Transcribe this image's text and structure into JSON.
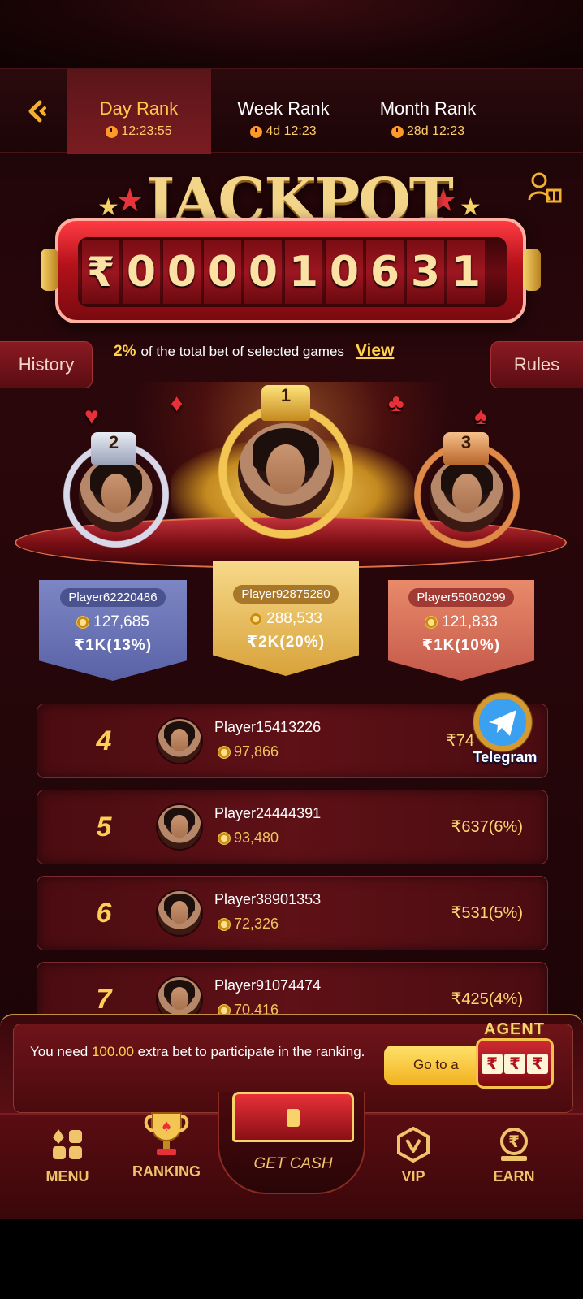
{
  "tabs": [
    {
      "label": "Day Rank",
      "timer": "12:23:55",
      "active": true
    },
    {
      "label": "Week Rank",
      "timer": "4d 12:23",
      "active": false
    },
    {
      "label": "Month Rank",
      "timer": "28d 12:23",
      "active": false
    }
  ],
  "jackpot": {
    "title": "JACKPOT",
    "currency": "₹",
    "digits": [
      "0",
      "0",
      "0",
      "0",
      "1",
      "0",
      "6",
      "3",
      "1"
    ]
  },
  "info": {
    "history": "History",
    "rules": "Rules",
    "percent": "2%",
    "text": "of the total bet of selected games",
    "view": "View"
  },
  "podium": {
    "first": {
      "rank": "1",
      "name": "Player92875280",
      "coins": "288,533",
      "prize": "₹2K(20%)"
    },
    "second": {
      "rank": "2",
      "name": "Player62220486",
      "coins": "127,685",
      "prize": "₹1K(13%)"
    },
    "third": {
      "rank": "3",
      "name": "Player55080299",
      "coins": "121,833",
      "prize": "₹1K(10%)"
    }
  },
  "ranks": [
    {
      "num": "4",
      "name": "Player15413226",
      "coins": "97,866",
      "prize": "₹74"
    },
    {
      "num": "5",
      "name": "Player24444391",
      "coins": "93,480",
      "prize": "₹637(6%)"
    },
    {
      "num": "6",
      "name": "Player38901353",
      "coins": "72,326",
      "prize": "₹531(5%)"
    },
    {
      "num": "7",
      "name": "Player91074474",
      "coins": "70,416",
      "prize": "₹425(4%)"
    }
  ],
  "telegram": "Telegram",
  "notice": {
    "pre": "You need ",
    "amount": "100.00",
    "post": " extra bet to participate in the ranking.",
    "button": "Go to a"
  },
  "agent": {
    "label": "AGENT",
    "symbol": "₹"
  },
  "nav": {
    "menu": "MENU",
    "ranking": "RANKING",
    "getcash": "GET CASH",
    "vip": "VIP",
    "earn": "EARN"
  },
  "colors": {
    "gold": "#ffcf55",
    "accent_red": "#c2313a",
    "background": "#2a070b"
  }
}
